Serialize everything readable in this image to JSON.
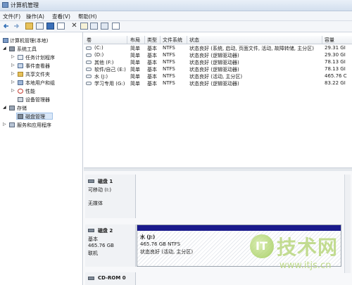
{
  "window": {
    "title": "计算机管理"
  },
  "menu": [
    "文件(F)",
    "操作(A)",
    "查看(V)",
    "帮助(H)"
  ],
  "colors": {
    "partition_bar": "#1a1a8c",
    "selection": "#d9e7f8",
    "watermark": "#b9d77e"
  },
  "tree": {
    "root": "计算机管理(本地)",
    "system_tools": "系统工具",
    "task_scheduler": "任务计划程序",
    "event_viewer": "事件查看器",
    "shared_folders": "共享文件夹",
    "local_users": "本地用户和组",
    "performance": "性能",
    "device_manager": "设备管理器",
    "storage": "存储",
    "disk_management": "磁盘管理",
    "services_apps": "服务和应用程序"
  },
  "volume_table": {
    "headers": [
      "卷",
      "布局",
      "类型",
      "文件系统",
      "状态",
      "容量"
    ],
    "rows": [
      [
        "(C:)",
        "简单",
        "基本",
        "NTFS",
        "状态良好 (系统, 启动, 页面文件, 活动, 故障转储, 主分区)",
        "29.31 GI"
      ],
      [
        "(D:)",
        "简单",
        "基本",
        "NTFS",
        "状态良好 (逻辑驱动器)",
        "29.30 GI"
      ],
      [
        "其他 (F:)",
        "简单",
        "基本",
        "NTFS",
        "状态良好 (逻辑驱动器)",
        "78.13 GI"
      ],
      [
        "软件/自己 (E:)",
        "简单",
        "基本",
        "NTFS",
        "状态良好 (逻辑驱动器)",
        "78.13 GI"
      ],
      [
        "水 (J:)",
        "简单",
        "基本",
        "NTFS",
        "状态良好 (活动, 主分区)",
        "465.76 C"
      ],
      [
        "学习专用 (G:)",
        "简单",
        "基本",
        "NTFS",
        "状态良好 (逻辑驱动器)",
        "83.22 GI"
      ]
    ]
  },
  "disks": {
    "disk1": {
      "name": "磁盘 1",
      "type": "可移动 (I:)",
      "status": "无媒体"
    },
    "disk2": {
      "name": "磁盘 2",
      "type": "基本",
      "size": "465.76 GB",
      "status": "联机"
    },
    "partition": {
      "name": "水 (J:)",
      "size": "465.76 GB NTFS",
      "status": "状态良好 (活动, 主分区)"
    },
    "cdrom": {
      "name": "CD-ROM 0"
    }
  },
  "watermark": {
    "logo": "IT",
    "brand": "技术网",
    "url": "www.itjs.cn"
  }
}
